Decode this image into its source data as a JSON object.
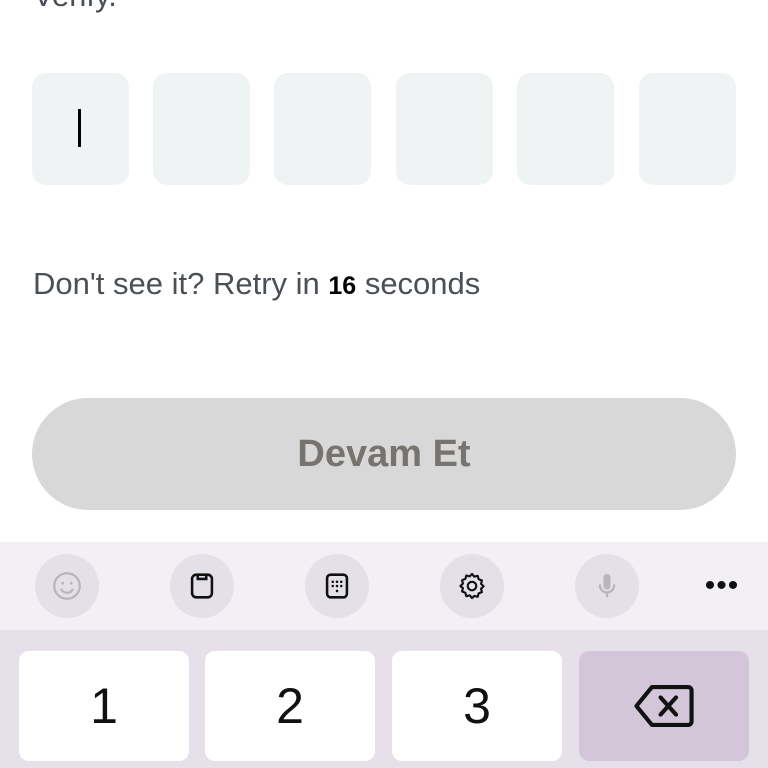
{
  "header": {
    "partial_text": "Verify."
  },
  "otp": {
    "digit_count": 6,
    "active_index": 0
  },
  "retry": {
    "prefix": "Don't see it? Retry in ",
    "seconds": "16",
    "suffix": " seconds"
  },
  "continue_button": {
    "label": "Devam Et"
  },
  "keyboard": {
    "toolbar": [
      "emoji-icon",
      "clipboard-icon",
      "numpad-icon",
      "settings-icon",
      "microphone-icon",
      "more-icon"
    ],
    "more_label": "•••",
    "keys": {
      "one": "1",
      "two": "2",
      "three": "3"
    },
    "delete_icon": "backspace-icon"
  },
  "colors": {
    "otp_box": "#f0f3f3",
    "button_bg": "#d8d8d8",
    "button_text": "#77736e",
    "keyboard_bg": "#e6e0ea",
    "delete_key": "#d2c6d8"
  }
}
